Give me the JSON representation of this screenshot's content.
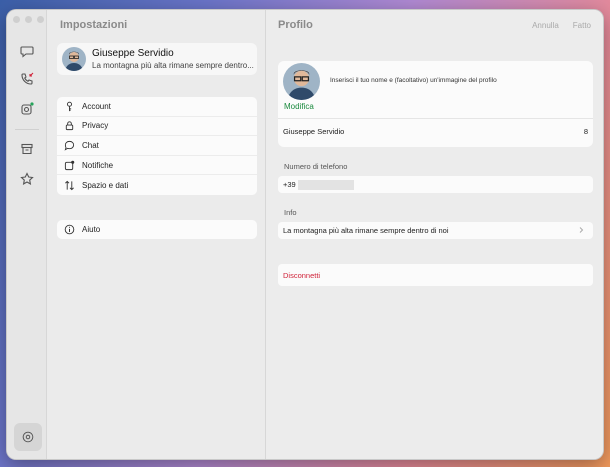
{
  "rail": {
    "icons": [
      "chat-bubble-icon",
      "phone-icon",
      "status-icon",
      "archive-icon",
      "star-icon",
      "settings-gear-icon"
    ]
  },
  "settings": {
    "title": "Impostazioni",
    "profile": {
      "name": "Giuseppe Servidio",
      "status": "La montagna più alta rimane sempre dentro..."
    },
    "menu": [
      {
        "label": "Account",
        "icon": "key-icon"
      },
      {
        "label": "Privacy",
        "icon": "lock-icon"
      },
      {
        "label": "Chat",
        "icon": "chat-icon"
      },
      {
        "label": "Notifiche",
        "icon": "notification-icon"
      },
      {
        "label": "Spazio e dati",
        "icon": "data-arrows-icon"
      }
    ],
    "help": {
      "label": "Aiuto",
      "icon": "info-icon"
    }
  },
  "profile_pane": {
    "title": "Profilo",
    "cancel_label": "Annulla",
    "done_label": "Fatto",
    "edit_photo_label": "Modifica",
    "photo_hint": "Inserisci il tuo nome e (facoltativo) un'immagine del profilo",
    "name_value": "Giuseppe Servidio",
    "name_counter": "8",
    "phone_label": "Numero di telefono",
    "phone_prefix": "+39",
    "info_label": "Info",
    "info_value": "La montagna più alta rimane sempre dentro di noi",
    "disconnect_label": "Disconnetti"
  },
  "colors": {
    "accent_green": "#1a8a3e",
    "danger_red": "#d0243a",
    "unread_badge": "#d0243a"
  }
}
